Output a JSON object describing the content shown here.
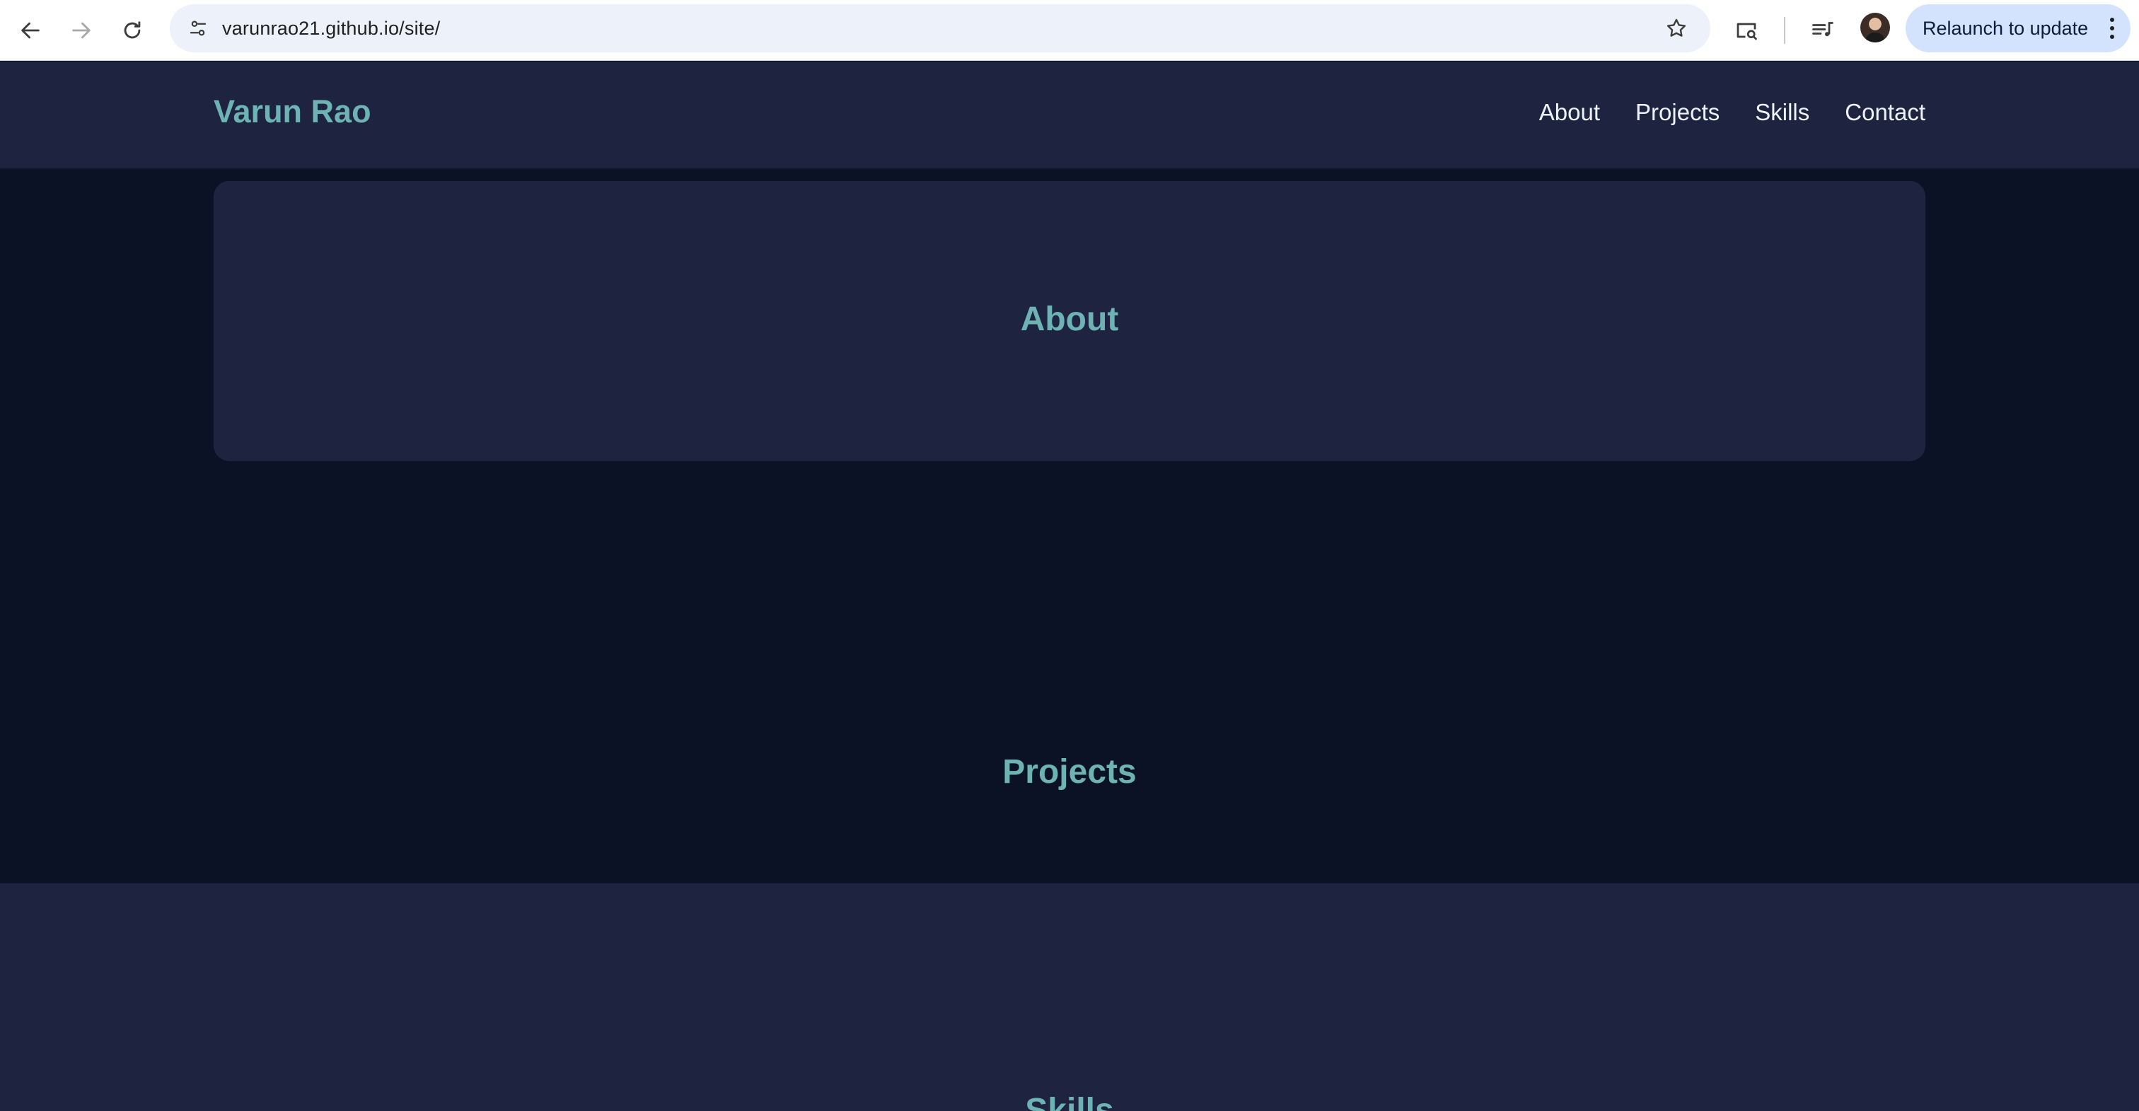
{
  "browser": {
    "url": "varunrao21.github.io/site/",
    "relaunch_label": "Relaunch to update",
    "icons": {
      "back": "arrow-left-icon",
      "forward": "arrow-right-icon",
      "reload": "reload-icon",
      "site_info": "tune-icon",
      "bookmark": "star-icon",
      "screen_search": "screen-search-icon",
      "media": "media-controls-icon",
      "menu": "kebab-menu-icon"
    }
  },
  "site": {
    "brand": "Varun Rao",
    "nav": [
      "About",
      "Projects",
      "Skills",
      "Contact"
    ]
  },
  "sections": {
    "about": "About",
    "projects": "Projects",
    "skills": "Skills"
  },
  "colors": {
    "accent": "#6db3b3",
    "header_bg": "#1e2440",
    "page_bg": "#0c1226",
    "nav_text": "#eef1f7"
  }
}
